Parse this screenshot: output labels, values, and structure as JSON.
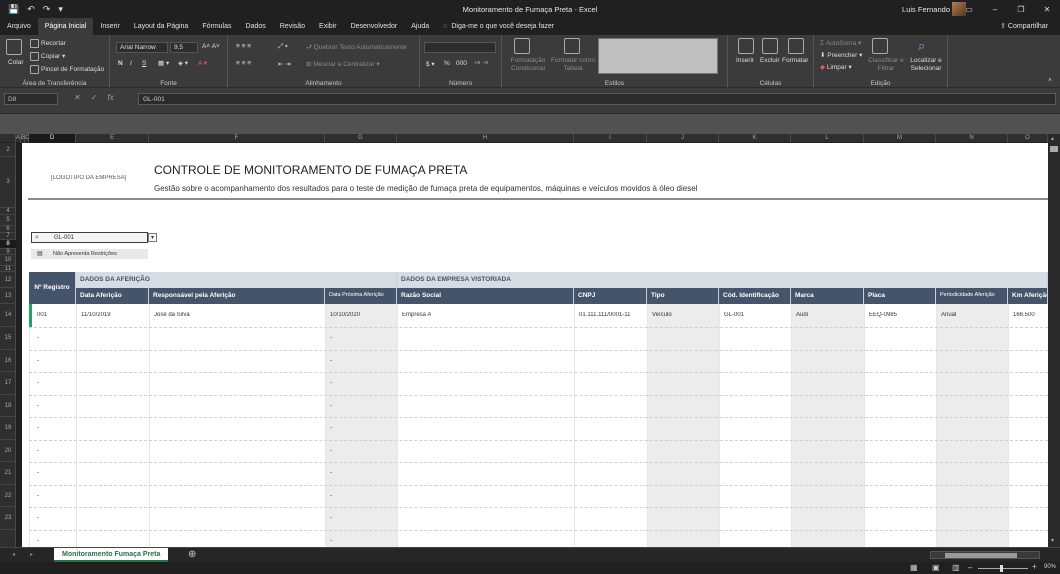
{
  "app": {
    "title": "Monitoramento de Fumaça Preta  -  Excel",
    "user": "Luis Fernando",
    "share": "Compartilhar"
  },
  "tabs": [
    "Arquivo",
    "Página Inicial",
    "Inserir",
    "Layout da Página",
    "Fórmulas",
    "Dados",
    "Revisão",
    "Exibir",
    "Desenvolvedor",
    "Ajuda"
  ],
  "tell_me": "Diga-me o que você deseja fazer",
  "ribbon": {
    "clipboard": {
      "paste": "Colar",
      "cut": "Recortar",
      "copy": "Copiar",
      "painter": "Pincel de Formatação",
      "label": "Área de Transferência"
    },
    "font": {
      "name": "Arial Narrow",
      "size": "9,5",
      "bold": "N",
      "italic": "I",
      "underline": "S",
      "label": "Fonte"
    },
    "alignment": {
      "wrap": "Quebrar Texto Automaticamente",
      "merge": "Mesclar e Centralizar",
      "label": "Alinhamento"
    },
    "number": {
      "label": "Número",
      "percent": "%",
      "thousands": "000"
    },
    "styles": {
      "conditional": "Formatação Condicional",
      "table": "Formatar como Tabela",
      "label": "Estilos"
    },
    "cells": {
      "insert": "Inserir",
      "delete": "Excluir",
      "format": "Formatar",
      "label": "Células"
    },
    "editing": {
      "autosum": "AutoSoma",
      "fill": "Preencher",
      "clear": "Limpar",
      "sort": "Classificar e Filtrar",
      "find": "Localizar e Selecionar",
      "label": "Edição"
    }
  },
  "formula_bar": {
    "name_box": "D8",
    "content": "GL-001"
  },
  "columns": [
    "A",
    "B",
    "C",
    "D",
    "E",
    "F",
    "G",
    "H",
    "I",
    "J",
    "K",
    "L",
    "M",
    "N",
    "O"
  ],
  "rows": [
    "2",
    "3",
    "4",
    "5",
    "6",
    "7",
    "8",
    "9",
    "10",
    "11",
    "12",
    "13",
    "14",
    "15",
    "16",
    "17",
    "18",
    "19",
    "20",
    "21",
    "22",
    "23"
  ],
  "sheet": {
    "logo": "[LOGOTIPO DA EMPRESA]",
    "title": "CONTROLE DE MONITORAMENTO DE FUMAÇA PRETA",
    "subtitle": "Gestão sobre o acompanhamento dos resultados para o teste de medição de fumaça preta de equipamentos, máquinas e veículos movidos à óleo diesel",
    "search_value": "GL-001",
    "restriction": "Não Apresenta Restrições",
    "group_afericao": "DADOS DA AFERIÇÃO",
    "group_empresa": "DADOS DA EMPRESA VISTORIADA",
    "headers": [
      "Nº Registro",
      "Data Aferição",
      "Responsável pela Aferição",
      "Data Próxima Aferição",
      "Razão Social",
      "CNPJ",
      "Tipo",
      "Cód. Identificação",
      "Marca",
      "Placa",
      "Periodicidade Aferição",
      "Km Aferição"
    ],
    "row1": [
      "001",
      "11/10/2019",
      "José da Silva",
      "10/10/2020",
      "Empresa A",
      "01.111.111/0001-11",
      "Veículo",
      "GL-001",
      "Audi",
      "EEQ-0985",
      "Anual",
      "166.500"
    ],
    "dash": "-"
  },
  "sheet_tab": "Monitoramento Fumaça Preta",
  "zoom": "90%"
}
